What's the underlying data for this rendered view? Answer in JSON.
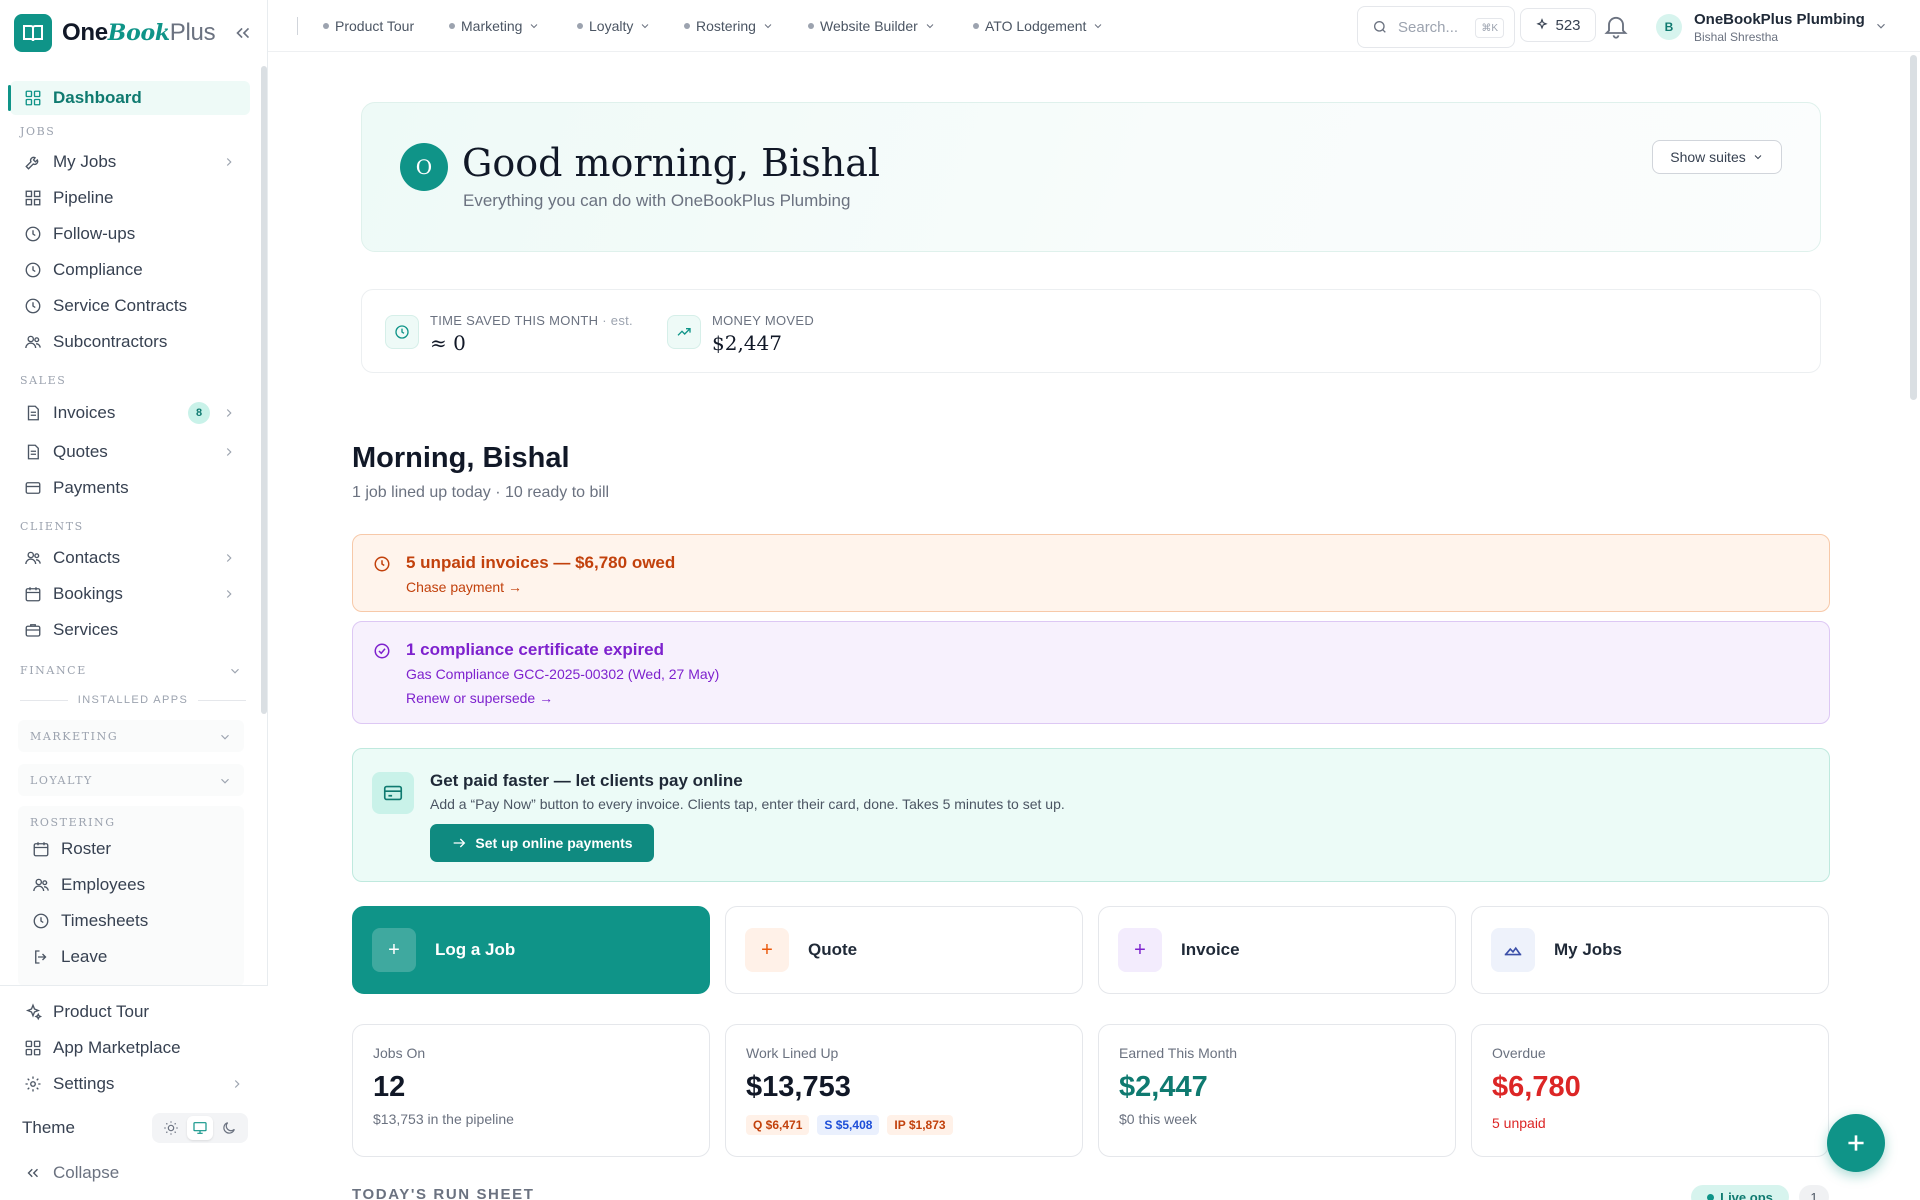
{
  "app": {
    "name_a": "One",
    "name_b": "Book",
    "name_c": "Plus"
  },
  "sidebar": {
    "dashboard": "Dashboard",
    "sections": {
      "jobs": "JOBS",
      "sales": "SALES",
      "clients": "CLIENTS",
      "finance": "FINANCE",
      "installed": "INSTALLED APPS"
    },
    "jobs": [
      "My Jobs",
      "Pipeline",
      "Follow-ups",
      "Compliance",
      "Service Contracts",
      "Subcontractors"
    ],
    "sales": {
      "invoices": "Invoices",
      "invoices_count": "8",
      "quotes": "Quotes",
      "payments": "Payments"
    },
    "clients": [
      "Contacts",
      "Bookings",
      "Services"
    ],
    "installed_groups": {
      "marketing": "MARKETING",
      "loyalty": "LOYALTY",
      "rostering": "ROSTERING"
    },
    "rostering": [
      "Roster",
      "Employees",
      "Timesheets",
      "Leave"
    ],
    "bottom": {
      "tour": "Product Tour",
      "marketplace": "App Marketplace",
      "settings": "Settings",
      "theme": "Theme",
      "collapse": "Collapse"
    }
  },
  "topbar": {
    "suites": [
      "Product Tour",
      "Marketing",
      "Loyalty",
      "Rostering",
      "Website Builder",
      "ATO Lodgement"
    ],
    "search_placeholder": "Search...",
    "search_kbd": "⌘K",
    "credits": "523",
    "account_name": "OneBookPlus Plumbing",
    "account_user": "Bishal Shrestha",
    "account_initial": "B"
  },
  "greeting": {
    "initial": "O",
    "title": "Good morning, Bishal",
    "subtitle": "Everything you can do with OneBookPlus Plumbing",
    "show_suites": "Show suites"
  },
  "stats": {
    "time_label": "TIME SAVED THIS MONTH",
    "time_est": "· est.",
    "time_value": "≈ 0",
    "money_label": "MONEY MOVED",
    "money_value": "$2,447"
  },
  "morning": {
    "title": "Morning, Bishal",
    "subtitle": "1 job lined up today · 10 ready to bill"
  },
  "alerts": {
    "unpaid_title": "5 unpaid invoices — $6,780 owed",
    "unpaid_link": "Chase payment →",
    "compliance_title": "1 compliance certificate expired",
    "compliance_detail": "Gas Compliance GCC-2025-00302 (Wed, 27 May)",
    "compliance_link": "Renew or supersede →",
    "pay_title": "Get paid faster — let clients pay online",
    "pay_desc": "Add a “Pay Now” button to every invoice. Clients tap, enter their card, done. Takes 5 minutes to set up.",
    "pay_button": "Set up online payments"
  },
  "quick_actions": [
    "Log a Job",
    "Quote",
    "Invoice",
    "My Jobs"
  ],
  "kpis": {
    "jobs_label": "Jobs On",
    "jobs_value": "12",
    "jobs_sub": "$13,753 in the pipeline",
    "work_label": "Work Lined Up",
    "work_value": "$13,753",
    "work_pills": [
      "Q $6,471",
      "S $5,408",
      "IP $1,873"
    ],
    "earned_label": "Earned This Month",
    "earned_value": "$2,447",
    "earned_sub": "$0 this week",
    "overdue_label": "Overdue",
    "overdue_value": "$6,780",
    "overdue_sub": "5 unpaid"
  },
  "run_sheet": {
    "title": "TODAY'S RUN SHEET",
    "live_ops": "Live ops",
    "count": "1"
  },
  "colors": {
    "brand": "#0f9488",
    "orange": "#c2410c",
    "purple": "#7e22ce",
    "red": "#dc2626"
  }
}
